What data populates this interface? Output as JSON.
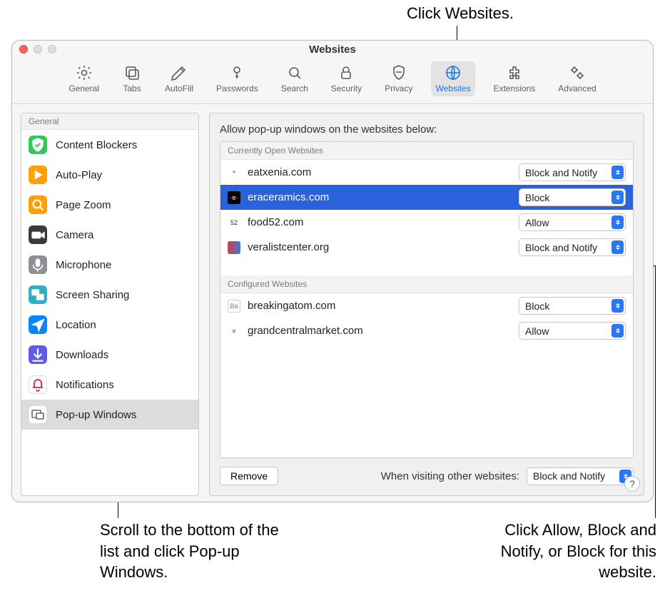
{
  "annotations": {
    "top": "Click Websites.",
    "bottom_left": "Scroll to the bottom of the list and click Pop-up Windows.",
    "bottom_right": "Click Allow, Block and Notify, or Block for this website."
  },
  "window": {
    "title": "Websites"
  },
  "toolbar": [
    {
      "id": "general",
      "label": "General"
    },
    {
      "id": "tabs",
      "label": "Tabs"
    },
    {
      "id": "autofill",
      "label": "AutoFill"
    },
    {
      "id": "passwords",
      "label": "Passwords"
    },
    {
      "id": "search",
      "label": "Search"
    },
    {
      "id": "security",
      "label": "Security"
    },
    {
      "id": "privacy",
      "label": "Privacy"
    },
    {
      "id": "websites",
      "label": "Websites",
      "active": true
    },
    {
      "id": "extensions",
      "label": "Extensions"
    },
    {
      "id": "advanced",
      "label": "Advanced"
    }
  ],
  "sidebar": {
    "header": "General",
    "items": [
      {
        "label": "Content Blockers",
        "icon_bg": "#34c759",
        "icon_kind": "shield"
      },
      {
        "label": "Auto-Play",
        "icon_bg": "#ff9f0a",
        "icon_kind": "play"
      },
      {
        "label": "Page Zoom",
        "icon_bg": "#ff9f0a",
        "icon_kind": "zoom"
      },
      {
        "label": "Camera",
        "icon_bg": "#3a3a3a",
        "icon_kind": "camera"
      },
      {
        "label": "Microphone",
        "icon_bg": "#8e8e93",
        "icon_kind": "mic"
      },
      {
        "label": "Screen Sharing",
        "icon_bg": "#30b0c7",
        "icon_kind": "screen"
      },
      {
        "label": "Location",
        "icon_bg": "#0a84ff",
        "icon_kind": "location"
      },
      {
        "label": "Downloads",
        "icon_bg": "#5e5ce6",
        "icon_kind": "download"
      },
      {
        "label": "Notifications",
        "icon_bg": "#ffffff",
        "icon_kind": "bell"
      },
      {
        "label": "Pop-up Windows",
        "icon_bg": "#ffffff",
        "icon_kind": "popup",
        "selected": true
      }
    ]
  },
  "main": {
    "title": "Allow pop-up windows on the websites below:",
    "sections": [
      {
        "header": "Currently Open Websites",
        "rows": [
          {
            "site": "eatxenia.com",
            "setting": "Block and Notify",
            "fav_bg": "#ffffff",
            "fav_text": "✶",
            "fav_color": "#d08a2a"
          },
          {
            "site": "eraceramics.com",
            "setting": "Block",
            "selected": true,
            "fav_bg": "#000000",
            "fav_text": "·ɐ·",
            "fav_color": "#ffffff"
          },
          {
            "site": "food52.com",
            "setting": "Allow",
            "fav_bg": "#ffffff",
            "fav_text": "52",
            "fav_color": "#333333"
          },
          {
            "site": "veralistcenter.org",
            "setting": "Block and Notify",
            "fav_bg": "linear-gradient(90deg,#d63a4a,#3a7ad6)",
            "fav_text": "",
            "fav_color": "#ffffff"
          }
        ]
      },
      {
        "header": "Configured Websites",
        "rows": [
          {
            "site": "breakingatom.com",
            "setting": "Block",
            "fav_bg": "#ffffff",
            "fav_text": "Ba",
            "fav_color": "#3aa05a",
            "fav_border": true
          },
          {
            "site": "grandcentralmarket.com",
            "setting": "Allow",
            "fav_bg": "#ffffff",
            "fav_text": "≡",
            "fav_color": "#555555"
          }
        ]
      }
    ],
    "remove_label": "Remove",
    "default_label": "When visiting other websites:",
    "default_value": "Block and Notify"
  },
  "help_label": "?"
}
